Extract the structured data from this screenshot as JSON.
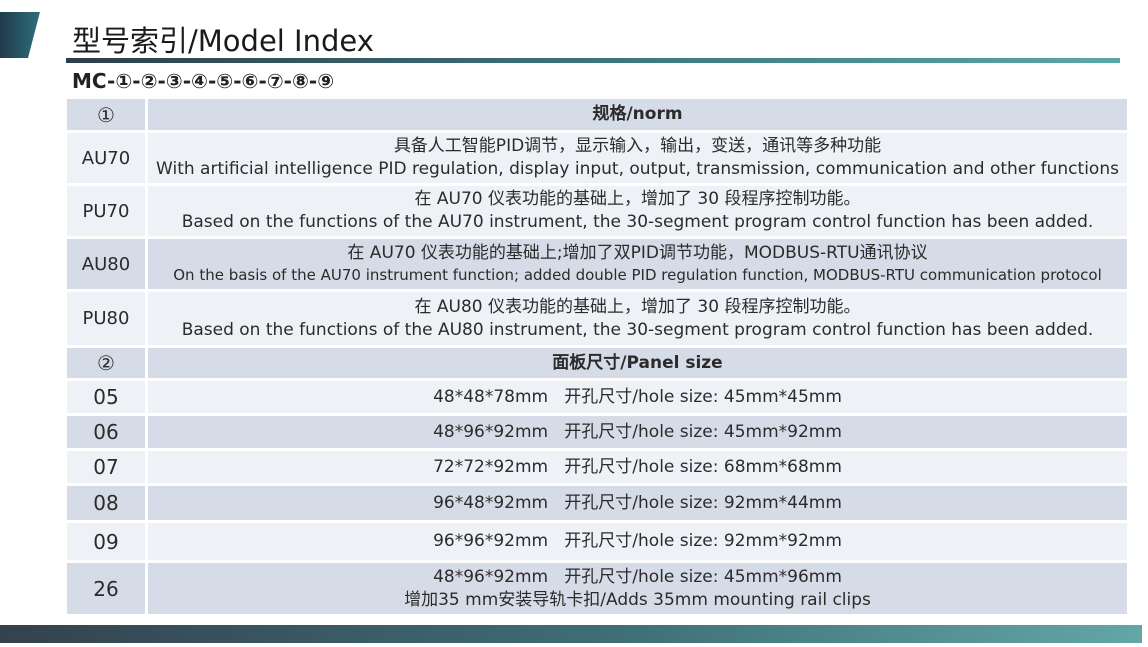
{
  "page": {
    "title": "型号索引/Model Index",
    "code": "MC-①-②-③-④-⑤-⑥-⑦-⑧-⑨"
  },
  "norm_section": {
    "marker": "①",
    "header": "规格/norm",
    "rows": [
      {
        "code": "AU70",
        "cn": "具备人工智能PID调节，显示输入，输出，变送，通讯等多种功能",
        "en": "With artificial intelligence PID regulation, display input, output, transmission, communication and other functions"
      },
      {
        "code": "PU70",
        "cn": "在 AU70 仪表功能的基础上，增加了 30 段程序控制功能。",
        "en": "Based on the functions of the AU70 instrument, the 30-segment program control function has been added."
      },
      {
        "code": "AU80",
        "cn": "在 AU70 仪表功能的基础上;增加了双PID调节功能，MODBUS-RTU通讯协议",
        "en": "On the basis of the AU70 instrument function; added double PID regulation function, MODBUS-RTU communication protocol"
      },
      {
        "code": "PU80",
        "cn": "在 AU80 仪表功能的基础上，增加了 30 段程序控制功能。",
        "en": "Based on the functions of the AU80 instrument, the 30-segment program control function has been added."
      }
    ]
  },
  "panel_section": {
    "marker": "②",
    "header": "面板尺寸/Panel size",
    "rows": [
      {
        "code": "05",
        "line1": "48*48*78mm   开孔尺寸/hole size: 45mm*45mm",
        "line2": ""
      },
      {
        "code": "06",
        "line1": "48*96*92mm   开孔尺寸/hole size: 45mm*92mm",
        "line2": ""
      },
      {
        "code": "07",
        "line1": "72*72*92mm   开孔尺寸/hole size: 68mm*68mm",
        "line2": ""
      },
      {
        "code": "08",
        "line1": "96*48*92mm   开孔尺寸/hole size: 92mm*44mm",
        "line2": ""
      },
      {
        "code": "09",
        "line1": "96*96*92mm   开孔尺寸/hole size: 92mm*92mm",
        "line2": ""
      },
      {
        "code": "26",
        "line1": "48*96*92mm   开孔尺寸/hole size: 45mm*96mm",
        "line2": "增加35 mm安装导轨卡扣/Adds 35mm mounting rail clips"
      }
    ]
  },
  "colors": {
    "row_light": "#eef1f6",
    "row_mid": "#d6dce7",
    "accent_dark": "#2d3e4a",
    "accent_teal": "#5aa7aa"
  }
}
